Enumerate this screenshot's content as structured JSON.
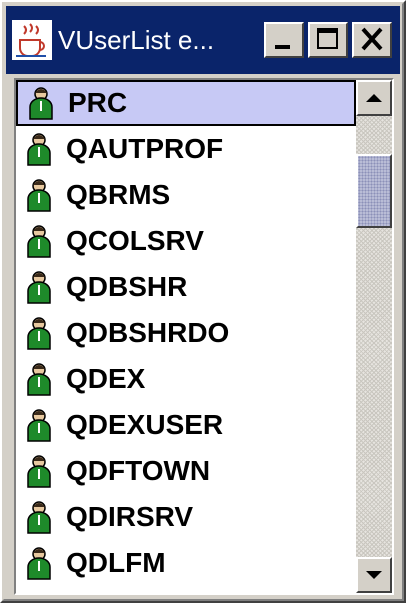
{
  "window": {
    "title": "VUserList e...",
    "app_icon": "java-coffee-cup-icon"
  },
  "title_buttons": {
    "minimize_icon": "minimize-icon",
    "maximize_icon": "maximize-icon",
    "close_icon": "close-icon"
  },
  "list": {
    "item_icon": "user-person-icon",
    "selected_index": 0,
    "items": [
      {
        "label": "PRC"
      },
      {
        "label": "QAUTPROF"
      },
      {
        "label": "QBRMS"
      },
      {
        "label": "QCOLSRV"
      },
      {
        "label": "QDBSHR"
      },
      {
        "label": "QDBSHRDO"
      },
      {
        "label": "QDEX"
      },
      {
        "label": "QDEXUSER"
      },
      {
        "label": "QDFTOWN"
      },
      {
        "label": "QDIRSRV"
      },
      {
        "label": "QDLFM"
      }
    ]
  },
  "scrollbar": {
    "up_icon": "up-arrow-icon",
    "down_icon": "down-arrow-icon"
  },
  "colors": {
    "title_bar": "#0a246a",
    "selection": "#c7c9f5",
    "person_green": "#1e8a2a"
  }
}
